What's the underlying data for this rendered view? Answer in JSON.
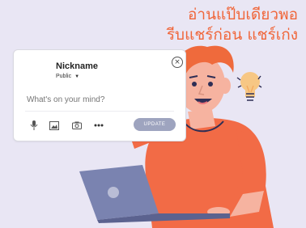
{
  "headline": {
    "line1": "อ่านแป๊บเดียวพอ",
    "line2": "รีบแชร์ก่อน แชร์เก่ง"
  },
  "post_card": {
    "nickname": "Nickname",
    "privacy": "Public",
    "input_placeholder": "What's on your mind?",
    "update_label": "UPDATE",
    "tools": [
      "microphone-icon",
      "image-icon",
      "camera-icon",
      "more-icon"
    ]
  },
  "colors": {
    "background": "#e9e6f4",
    "headline": "#f0663a",
    "shirt": "#f26b46",
    "hair": "#ef6a3c",
    "laptop": "#7a83b0",
    "update_button": "#9ea4bf",
    "bulb": "#f7c784"
  }
}
